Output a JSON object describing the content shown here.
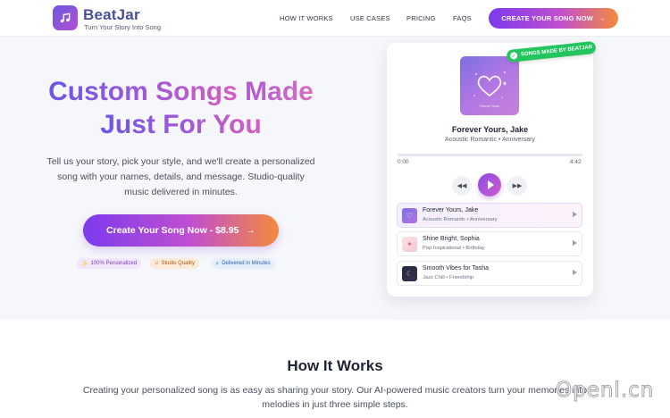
{
  "header": {
    "brand": "BeatJar",
    "tagline": "Turn Your Story Into Song",
    "nav": [
      "HOW IT WORKS",
      "USE CASES",
      "PRICING",
      "FAQS"
    ],
    "cta": "CREATE YOUR SONG NOW",
    "cta_icon": "arrow-right-icon"
  },
  "hero": {
    "title_line1_a": "Custom Songs",
    "title_line1_b": "Made",
    "title_line2": "Just For You",
    "description_lines": [
      "Tell us your story, pick your style, and we'll create a personalized",
      "song with your names, details, and message. Studio-quality",
      "music delivered in minutes."
    ],
    "cta": "Create Your Song Now - $8.95",
    "chips": [
      {
        "label": "100% Personalized",
        "icon": "sparkles-icon"
      },
      {
        "label": "Studio Quality",
        "icon": "music-note-icon"
      },
      {
        "label": "Delivered in Minutes",
        "icon": "lightning-icon"
      }
    ]
  },
  "player": {
    "badge": "SONGS MADE BY BEATJAR",
    "cover_caption": "Forever Yours",
    "now_playing_title": "Forever Yours, Jake",
    "now_playing_sub": "Acoustic Romantic • Anniversary",
    "time_current": "0:00",
    "time_total": "4:42",
    "progress": 0,
    "tracks": [
      {
        "title": "Forever Yours, Jake",
        "sub": "Acoustic Romantic • Anniversary",
        "active": true
      },
      {
        "title": "Shine Bright, Sophia",
        "sub": "Pop Inspirational • Birthday",
        "active": false
      },
      {
        "title": "Smooth Vibes for Tasha",
        "sub": "Jazz Chill • Friendship",
        "active": false
      }
    ]
  },
  "how": {
    "title": "How It Works",
    "description_lines": [
      "Creating your personalized song is as easy as sharing your story. Our AI-powered music creators turn your memories into",
      "melodies in just three simple steps."
    ]
  },
  "watermark": "Openl.cn",
  "colors": {
    "accent_purple": "#7c3aed",
    "accent_pink": "#c04fd0",
    "accent_orange": "#f48a3c",
    "badge_green": "#22c55e"
  }
}
